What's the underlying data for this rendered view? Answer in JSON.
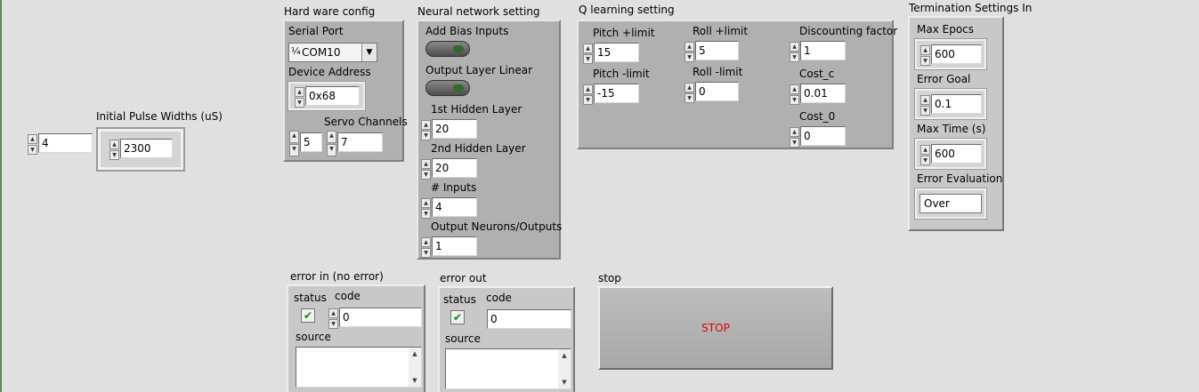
{
  "left_control": {
    "value": "4"
  },
  "pulse": {
    "label": "Initial Pulse Widths (uS)",
    "value": "2300"
  },
  "hardware": {
    "title": "Hard ware config",
    "serial_port_label": "Serial Port",
    "serial_port_value": "COM10",
    "device_address_label": "Device Address",
    "device_address_value": "0x68",
    "servo_channels_label": "Servo Channels",
    "servo_first_value": "5",
    "servo_second_value": "7"
  },
  "neural": {
    "title": "Neural network setting",
    "add_bias_label": "Add Bias Inputs",
    "output_linear_label": "Output Layer Linear",
    "hidden1_label": "1st Hidden Layer",
    "hidden1_value": "20",
    "hidden2_label": "2nd Hidden Layer",
    "hidden2_value": "20",
    "inputs_label": "# Inputs",
    "inputs_value": "4",
    "outputs_label": "Output Neurons/Outputs",
    "outputs_value": "1"
  },
  "qlearning": {
    "title": "Q learning setting",
    "pitch_plus_label": "Pitch +limit",
    "pitch_plus_value": "15",
    "pitch_minus_label": "Pitch -limit",
    "pitch_minus_value": "-15",
    "roll_plus_label": "Roll +limit",
    "roll_plus_value": "5",
    "roll_minus_label": "Roll -limit",
    "roll_minus_value": "0",
    "discount_label": "Discounting factor",
    "discount_value": "1",
    "cost_c_label": "Cost_c",
    "cost_c_value": "0.01",
    "cost_0_label": "Cost_0",
    "cost_0_value": "0"
  },
  "termination": {
    "title": "Termination Settings In",
    "max_epocs_label": "Max Epocs",
    "max_epocs_value": "600",
    "error_goal_label": "Error Goal",
    "error_goal_value": "0.1",
    "max_time_label": "Max Time (s)",
    "max_time_value": "600",
    "error_eval_label": "Error Evaluation",
    "error_eval_value": "Over"
  },
  "error_in": {
    "title": "error in (no error)",
    "status_label": "status",
    "code_label": "code",
    "code_value": "0",
    "source_label": "source"
  },
  "error_out": {
    "title": "error out",
    "status_label": "status",
    "code_label": "code",
    "code_value": "0",
    "source_label": "source"
  },
  "stop": {
    "label": "stop",
    "button_text": "STOP"
  }
}
